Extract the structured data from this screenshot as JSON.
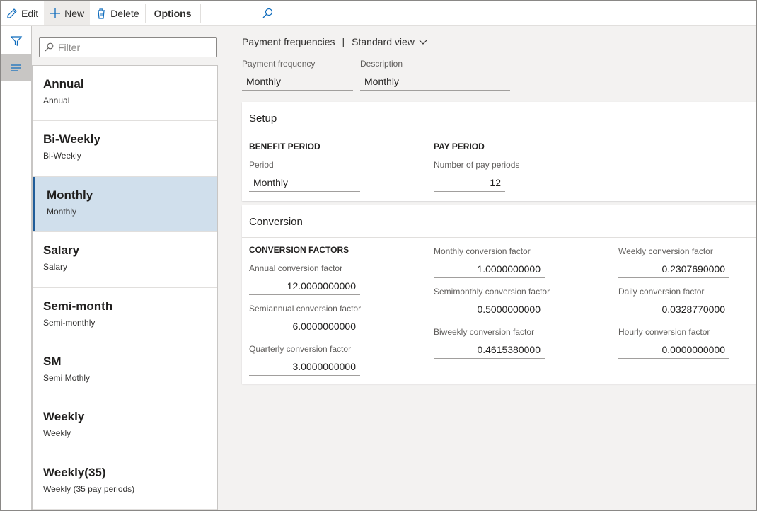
{
  "toolbar": {
    "edit": "Edit",
    "new": "New",
    "delete": "Delete",
    "options": "Options"
  },
  "filter": {
    "placeholder": "Filter"
  },
  "list": [
    {
      "name": "Annual",
      "desc": "Annual"
    },
    {
      "name": "Bi-Weekly",
      "desc": "Bi-Weekly"
    },
    {
      "name": "Monthly",
      "desc": "Monthly"
    },
    {
      "name": "Salary",
      "desc": "Salary"
    },
    {
      "name": "Semi-month",
      "desc": "Semi-monthly"
    },
    {
      "name": "SM",
      "desc": "Semi Mothly"
    },
    {
      "name": "Weekly",
      "desc": "Weekly"
    },
    {
      "name": "Weekly(35)",
      "desc": "Weekly (35 pay periods)"
    }
  ],
  "selected_index": 2,
  "title": {
    "page": "Payment frequencies",
    "separator": "|",
    "view": "Standard view"
  },
  "header": {
    "payment_frequency_label": "Payment frequency",
    "payment_frequency_value": "Monthly",
    "description_label": "Description",
    "description_value": "Monthly"
  },
  "setup": {
    "title": "Setup",
    "benefit_period": "BENEFIT PERIOD",
    "period_label": "Period",
    "period_value": "Monthly",
    "pay_period": "PAY PERIOD",
    "num_pay_periods_label": "Number of pay periods",
    "num_pay_periods_value": "12"
  },
  "conversion": {
    "title": "Conversion",
    "group_title": "CONVERSION FACTORS",
    "annual_label": "Annual conversion factor",
    "annual_value": "12.0000000000",
    "semiannual_label": "Semiannual conversion factor",
    "semiannual_value": "6.0000000000",
    "quarterly_label": "Quarterly conversion factor",
    "quarterly_value": "3.0000000000",
    "monthly_label": "Monthly conversion factor",
    "monthly_value": "1.0000000000",
    "semimonthly_label": "Semimonthly conversion factor",
    "semimonthly_value": "0.5000000000",
    "biweekly_label": "Biweekly conversion factor",
    "biweekly_value": "0.4615380000",
    "weekly_label": "Weekly conversion factor",
    "weekly_value": "0.2307690000",
    "daily_label": "Daily conversion factor",
    "daily_value": "0.0328770000",
    "hourly_label": "Hourly conversion factor",
    "hourly_value": "0.0000000000"
  },
  "colors": {
    "selected_bg": "#d0dfec",
    "selected_accent": "#1f5c99",
    "icon_blue": "#0f6cbd"
  }
}
